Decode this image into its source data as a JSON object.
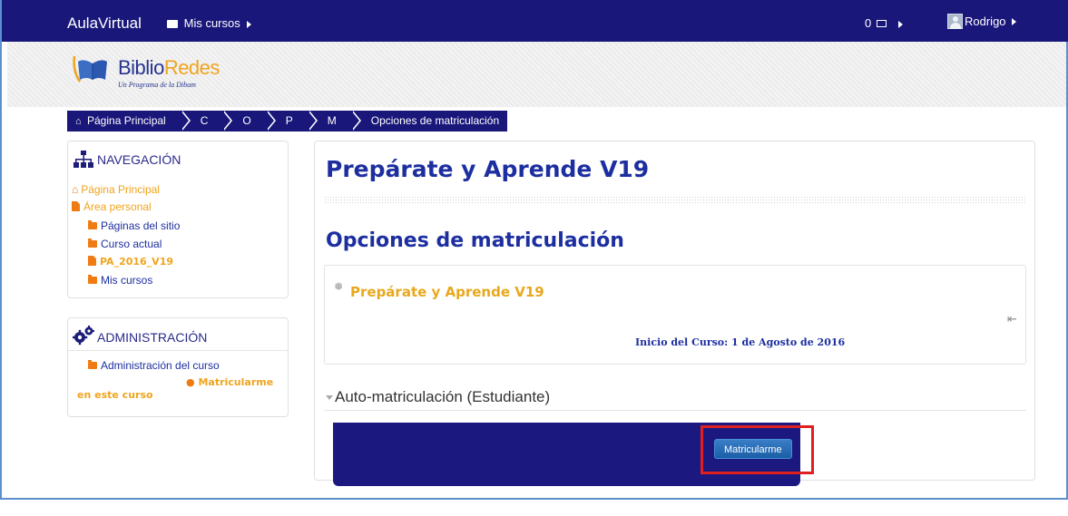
{
  "topbar": {
    "brand": "AulaVirtual",
    "mis_cursos": "Mis cursos",
    "messages": "0",
    "user": "Rodrigo"
  },
  "logo": {
    "name_a": "Biblio",
    "name_b": "Redes",
    "subtitle": "Un Programa de la Dibam"
  },
  "breadcrumb": [
    {
      "label": "Página Principal"
    },
    {
      "label": "C"
    },
    {
      "label": "O"
    },
    {
      "label": "P"
    },
    {
      "label": "M"
    },
    {
      "label": "Opciones de matriculación"
    }
  ],
  "navigation": {
    "title": "NAVEGACIÓN",
    "items": [
      {
        "label": "Página Principal"
      },
      {
        "label": "Área personal"
      },
      {
        "label": "Páginas del sitio"
      },
      {
        "label": "Curso actual"
      },
      {
        "label": "PA_2016_V19"
      },
      {
        "label": "Mis cursos"
      }
    ]
  },
  "administration": {
    "title": "ADMINISTRACIÓN",
    "items": [
      {
        "label": "Administración del curso"
      },
      {
        "label": "Matricularme en este curso"
      }
    ]
  },
  "main": {
    "course_title": "Prepárate y Aprende V19",
    "page_heading": "Opciones de matriculación",
    "course_box": {
      "name": "Prepárate y Aprende V19",
      "info": "Inicio del Curso: 1 de Agosto de 2016"
    },
    "section_title": "Auto-matriculación (Estudiante)",
    "enrol_button": "Matricularme"
  },
  "colors": {
    "nav_bg": "#19177a",
    "link": "#f0a41e",
    "heading": "#1d2fa0",
    "highlight": "#e02020"
  }
}
